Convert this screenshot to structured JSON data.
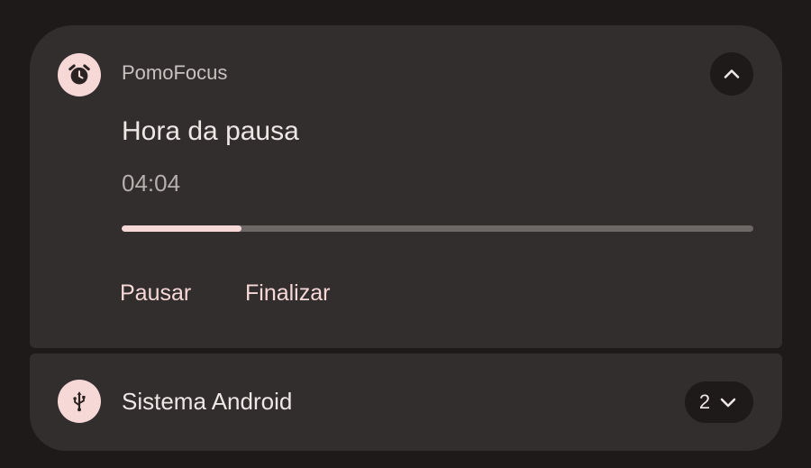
{
  "notification": {
    "app_name": "PomoFocus",
    "app_icon": "alarm-clock-icon",
    "title": "Hora da pausa",
    "timer": "04:04",
    "progress": 0.19,
    "actions": {
      "pause": "Pausar",
      "finish": "Finalizar"
    },
    "collapse_icon": "chevron-up-icon"
  },
  "group": {
    "title": "Sistema Android",
    "app_icon": "usb-icon",
    "count": "2",
    "expand_icon": "chevron-down-icon"
  },
  "colors": {
    "background": "#1e1a1a",
    "card": "#322e2e",
    "accent": "#f6d8d6",
    "track": "#6d6766",
    "primary_text": "#ede7e6",
    "secondary_text": "#c8c2c1"
  }
}
